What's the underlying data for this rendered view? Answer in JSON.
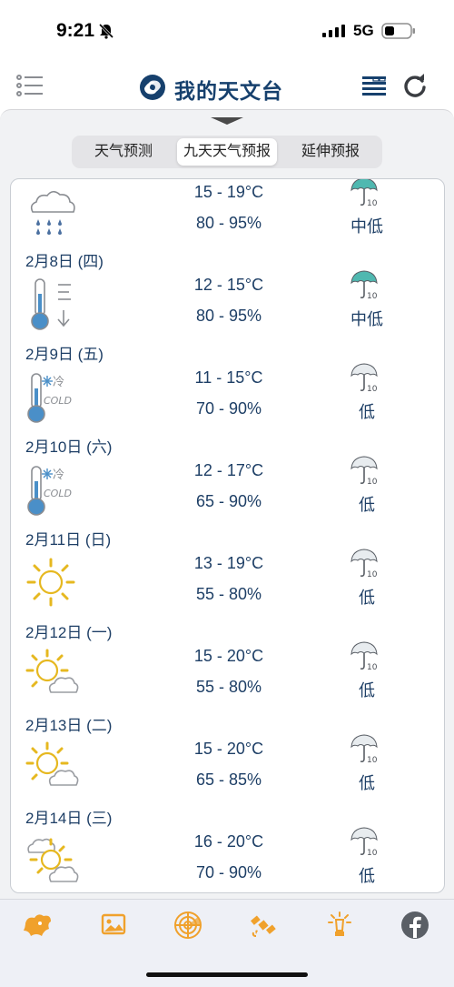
{
  "status_bar": {
    "time": "9:21",
    "network": "5G"
  },
  "app_bar": {
    "title": "我的天文台"
  },
  "tabs": [
    {
      "label": "天气预测",
      "active": false
    },
    {
      "label": "九天天气预报",
      "active": true
    },
    {
      "label": "延伸预报",
      "active": false
    }
  ],
  "forecast": [
    {
      "date": "",
      "icon": "rain-cloud-icon",
      "temp": "15 - 19°C",
      "humidity": "80 - 95%",
      "umbrella": "umbrella-icon",
      "risk": "中低"
    },
    {
      "date": "2月8日 (四)",
      "icon": "temperature-drop-icon",
      "temp": "12 - 15°C",
      "humidity": "80 - 95%",
      "umbrella": "umbrella-icon",
      "risk": "中低"
    },
    {
      "date": "2月9日 (五)",
      "icon": "cold-icon",
      "icon_label": "COLD",
      "icon_text": "冷",
      "temp": "11 - 15°C",
      "humidity": "70 - 90%",
      "umbrella": "umbrella-icon",
      "risk": "低"
    },
    {
      "date": "2月10日 (六)",
      "icon": "cold-icon",
      "icon_label": "COLD",
      "icon_text": "冷",
      "temp": "12 - 17°C",
      "humidity": "65 - 90%",
      "umbrella": "umbrella-icon",
      "risk": "低"
    },
    {
      "date": "2月11日 (日)",
      "icon": "sunny-icon",
      "temp": "13 - 19°C",
      "humidity": "55 - 80%",
      "umbrella": "umbrella-icon",
      "risk": "低"
    },
    {
      "date": "2月12日 (一)",
      "icon": "sunny-periods-icon",
      "temp": "15 - 20°C",
      "humidity": "55 - 80%",
      "umbrella": "umbrella-icon",
      "risk": "低"
    },
    {
      "date": "2月13日 (二)",
      "icon": "sunny-periods-icon",
      "temp": "15 - 20°C",
      "humidity": "65 - 85%",
      "umbrella": "umbrella-icon",
      "risk": "低"
    },
    {
      "date": "2月14日 (三)",
      "icon": "sunny-intervals-icon",
      "temp": "16 - 20°C",
      "humidity": "70 - 90%",
      "umbrella": "umbrella-icon",
      "risk": "低"
    }
  ],
  "umbrella_label": "10",
  "colors": {
    "accent": "#f0a12c",
    "text": "#1e3f66",
    "umbrella": "#4fb8b0"
  }
}
